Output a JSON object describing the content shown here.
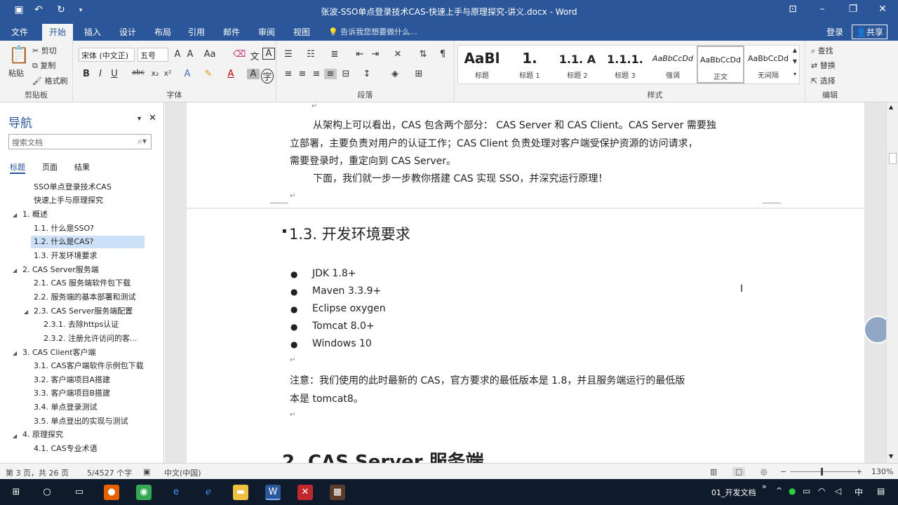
{
  "titlebar": {
    "title": "张波-SSO单点登录技术CAS-快速上手与原理探究-讲义.docx - Word"
  },
  "ribbon_tabs": [
    "文件",
    "开始",
    "插入",
    "设计",
    "布局",
    "引用",
    "邮件",
    "审阅",
    "视图"
  ],
  "tell_me": "告诉我您想要做什么...",
  "signin": "登录",
  "share": "共享",
  "clipboard": {
    "paste": "粘贴",
    "cut": "剪切",
    "copy": "复制",
    "format_painter": "格式刷",
    "label": "剪贴板"
  },
  "font": {
    "name": "宋体 (中文正)",
    "size": "五号",
    "label": "字体"
  },
  "paragraph": {
    "label": "段落"
  },
  "styles": {
    "items": [
      {
        "sample": "AaBl",
        "name": "标题"
      },
      {
        "sample": "1.",
        "name": "标题 1"
      },
      {
        "sample": "1.1. A",
        "name": "标题 2"
      },
      {
        "sample": "1.1.1.",
        "name": "标题 3"
      },
      {
        "sample": "AaBbCcDd",
        "name": "强调"
      },
      {
        "sample": "AaBbCcDd",
        "name": "正文"
      },
      {
        "sample": "AaBbCcDd",
        "name": "无间隔"
      }
    ],
    "label": "样式"
  },
  "editing": {
    "find": "查找",
    "replace": "替换",
    "select": "选择",
    "label": "编辑"
  },
  "nav": {
    "title": "导航",
    "search_placeholder": "搜索文档",
    "tabs": [
      "标题",
      "页面",
      "结果"
    ],
    "items": [
      "SSO单点登录技术CAS",
      "快速上手与原理探究",
      "1. 概述",
      "1.1. 什么是SSO?",
      "1.2. 什么是CAS?",
      "1.3. 开发环境要求",
      "2. CAS Server服务端",
      "2.1. CAS 服务端软件包下载",
      "2.2. 服务端的基本部署和测试",
      "2.3. CAS Server服务端配置",
      "2.3.1. 去除https认证",
      "2.3.2. 注册允许访问的客...",
      "3. CAS Client客户端",
      "3.1. CAS客户端软件示例包下载",
      "3.2. 客户端项目A搭建",
      "3.3. 客户端项目B搭建",
      "3.4. 单点登录测试",
      "3.5. 单点登出的实现与测试",
      "4. 原理探究",
      "4.1. CAS专业术语"
    ]
  },
  "doc": {
    "p1a": "从架构上可以看出，CAS 包含两个部分： CAS Server 和 CAS Client。CAS Server 需要独",
    "p1b": "立部署，主要负责对用户的认证工作；CAS Client 负责处理对客户端受保护资源的访问请求，",
    "p1c": "需要登录时，重定向到 CAS Server。",
    "p2": "下面，我们就一步一步教你搭建 CAS 实现 SSO，并深究运行原理！",
    "h13": "1.3. 开发环境要求",
    "bullets": [
      "JDK 1.8+",
      "Maven 3.3.9+",
      "Eclipse oxygen",
      "Tomcat 8.0+",
      "Windows 10"
    ],
    "note1": "注意：我们使用的此时最新的 CAS，官方要求的最低版本是 1.8，并且服务端运行的最低版",
    "note2": "本是 tomcat8。",
    "h2": "2. CAS Server 服务端"
  },
  "status": {
    "page": "第 3 页，共 26 页",
    "words": "5/4527 个字",
    "lang": "中文(中国)",
    "zoom": "130%"
  },
  "taskbar": {
    "active_label": "01_开发文档"
  }
}
